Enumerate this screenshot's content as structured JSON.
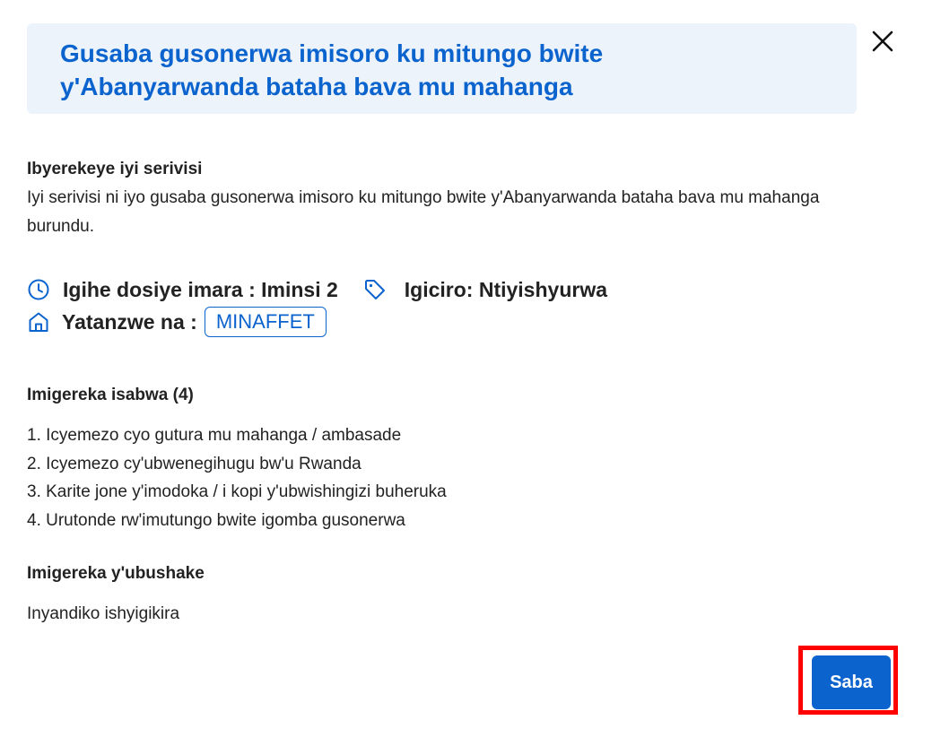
{
  "dialog": {
    "title": "Gusaba gusonerwa imisoro ku mitungo bwite y'Abanyarwanda bataha bava mu mahanga",
    "close_icon": "close-icon"
  },
  "description": {
    "heading": "Ibyerekeye iyi serivisi",
    "text": "Iyi serivisi ni iyo gusaba gusonerwa imisoro ku mitungo bwite y'Abanyarwanda bataha bava mu mahanga burundu."
  },
  "meta": {
    "duration": "Igihe dosiye imara : Iminsi 2",
    "price": "Igiciro: Ntiyishyurwa",
    "provider_label": "Yatanzwe na :",
    "provider": "MINAFFET",
    "icons": [
      "clock-icon",
      "tag-icon",
      "home-icon"
    ]
  },
  "required_docs": {
    "heading": "Imigereka isabwa (4)",
    "items": [
      "1. Icyemezo cyo gutura mu mahanga / ambasade",
      "2. Icyemezo cy'ubwenegihugu bw'u Rwanda",
      "3. Karite jone y'imodoka / i kopi y'ubwishingizi buheruka",
      "4. Urutonde rw'imutungo bwite igomba gusonerwa"
    ]
  },
  "optional_docs": {
    "heading": "Imigereka y'ubushake",
    "text": "Inyandiko ishyigikira"
  },
  "actions": {
    "apply_label": "Saba"
  },
  "colors": {
    "accent": "#0b63ce",
    "header_bg": "#edf3fa",
    "highlight": "#ff0000"
  }
}
